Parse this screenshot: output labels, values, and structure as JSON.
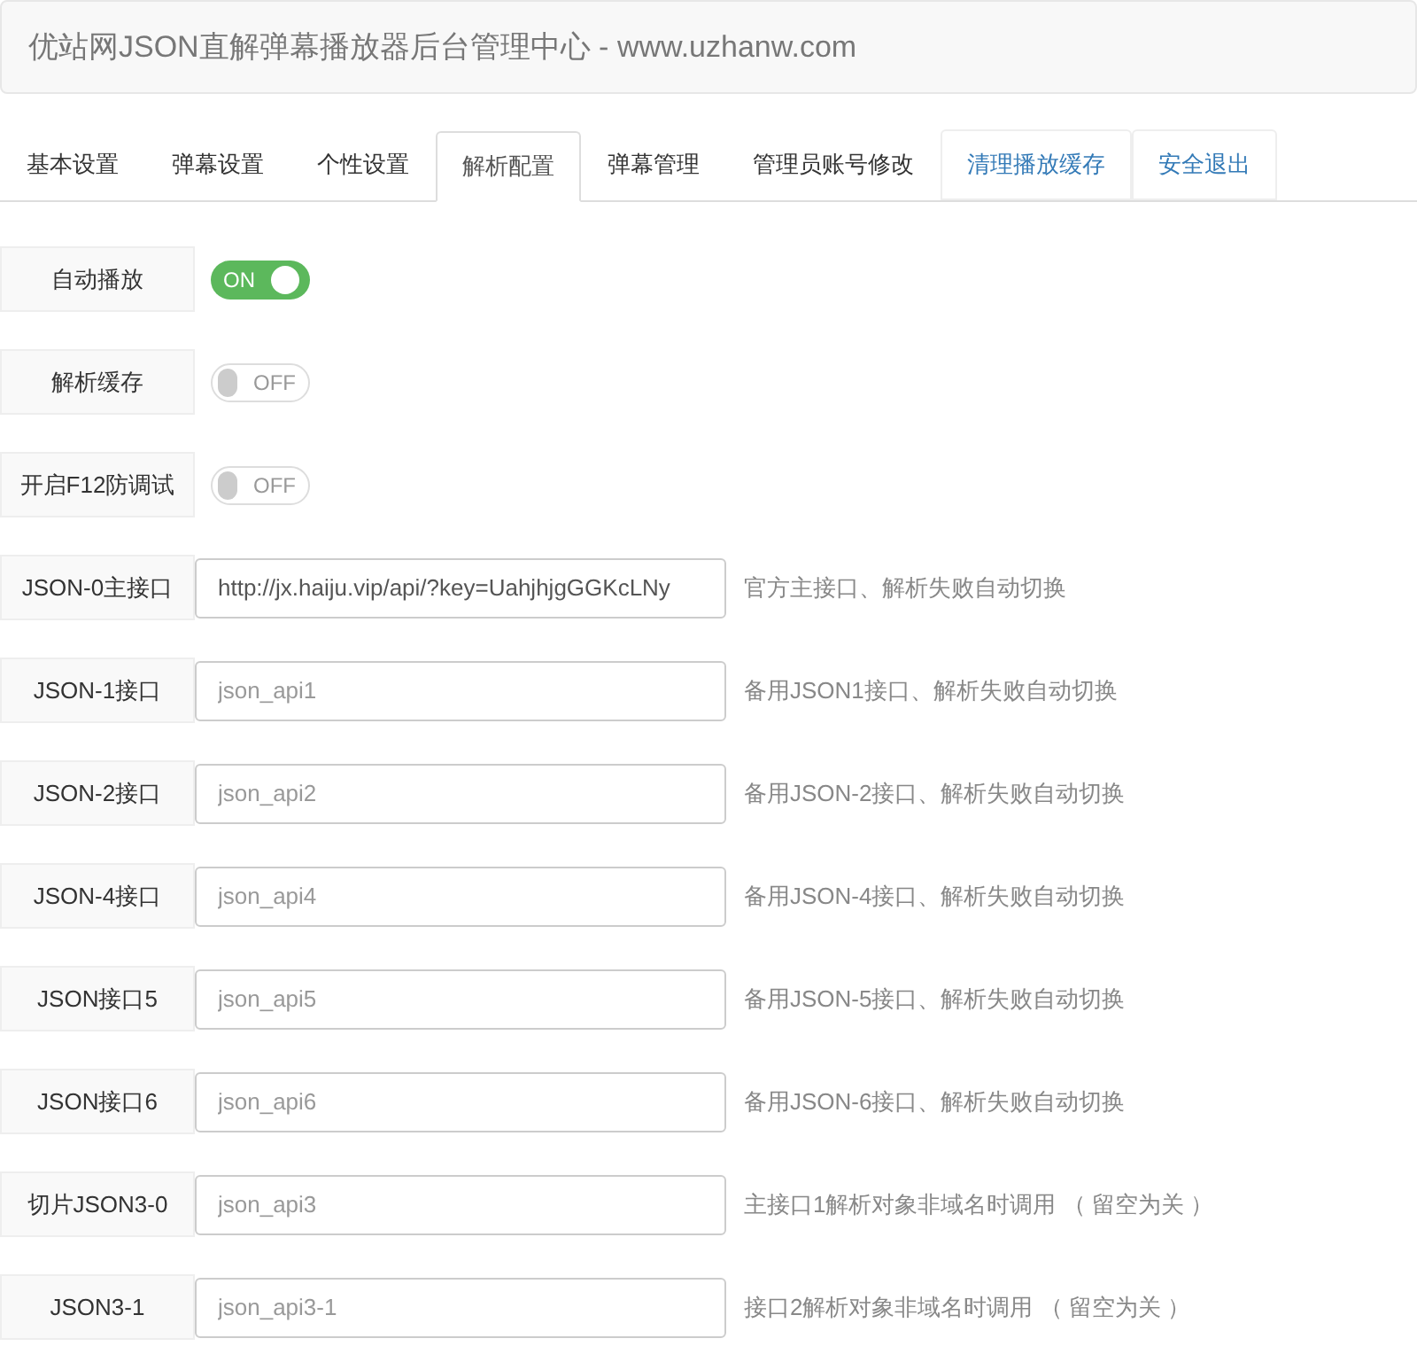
{
  "header": {
    "title": "优站网JSON直解弹幕播放器后台管理中心 - www.uzhanw.com"
  },
  "tabs": [
    {
      "label": "基本设置",
      "kind": "tab",
      "selected": false
    },
    {
      "label": "弹幕设置",
      "kind": "tab",
      "selected": false
    },
    {
      "label": "个性设置",
      "kind": "tab",
      "selected": false
    },
    {
      "label": "解析配置",
      "kind": "tab",
      "selected": true
    },
    {
      "label": "弹幕管理",
      "kind": "tab",
      "selected": false
    },
    {
      "label": "管理员账号修改",
      "kind": "tab",
      "selected": false
    },
    {
      "label": "清理播放缓存",
      "kind": "action",
      "selected": false
    },
    {
      "label": "安全退出",
      "kind": "action",
      "selected": false
    }
  ],
  "settings": [
    {
      "kind": "switch",
      "label": "自动播放",
      "on": true,
      "state_text": "ON"
    },
    {
      "kind": "switch",
      "label": "解析缓存",
      "on": false,
      "state_text": "OFF"
    },
    {
      "kind": "switch",
      "label": "开启F12防调试",
      "on": false,
      "state_text": "OFF"
    },
    {
      "kind": "input",
      "label": "JSON-0主接口",
      "value": "http://jx.haiju.vip/api/?key=UahjhjgGGKcLNy",
      "help": "官方主接口、解析失败自动切换"
    },
    {
      "kind": "input",
      "label": "JSON-1接口",
      "placeholder": "json_api1",
      "help": "备用JSON1接口、解析失败自动切换"
    },
    {
      "kind": "input",
      "label": "JSON-2接口",
      "placeholder": "json_api2",
      "help": "备用JSON-2接口、解析失败自动切换"
    },
    {
      "kind": "input",
      "label": "JSON-4接口",
      "placeholder": "json_api4",
      "help": "备用JSON-4接口、解析失败自动切换"
    },
    {
      "kind": "input",
      "label": "JSON接口5",
      "placeholder": "json_api5",
      "help": "备用JSON-5接口、解析失败自动切换"
    },
    {
      "kind": "input",
      "label": "JSON接口6",
      "placeholder": "json_api6",
      "help": "备用JSON-6接口、解析失败自动切换"
    },
    {
      "kind": "input",
      "label": "切片JSON3-0",
      "placeholder": "json_api3",
      "help": "主接口1解析对象非域名时调用 （ 留空为关 ）"
    },
    {
      "kind": "input",
      "label": "JSON3-1",
      "placeholder": "json_api3-1",
      "help": "接口2解析对象非域名时调用 （ 留空为关 ）"
    }
  ]
}
